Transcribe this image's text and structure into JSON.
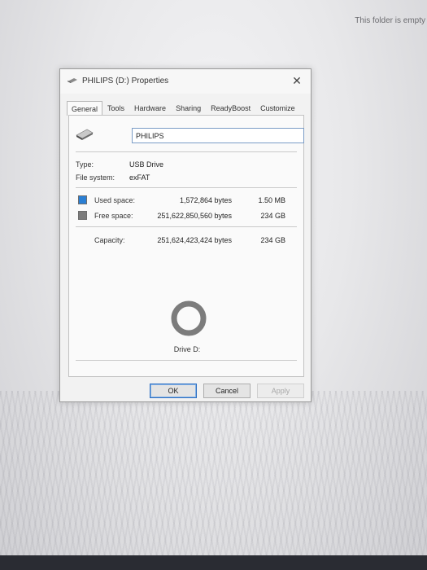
{
  "background": {
    "folder_status": "This folder is empty"
  },
  "dialog": {
    "title": "PHILIPS (D:) Properties",
    "close_glyph": "✕"
  },
  "tabs": [
    {
      "label": "General",
      "active": true
    },
    {
      "label": "Tools"
    },
    {
      "label": "Hardware"
    },
    {
      "label": "Sharing"
    },
    {
      "label": "ReadyBoost"
    },
    {
      "label": "Customize"
    }
  ],
  "general": {
    "volume_label": "PHILIPS",
    "type_label": "Type:",
    "type_value": "USB Drive",
    "fs_label": "File system:",
    "fs_value": "exFAT",
    "used": {
      "label": "Used space:",
      "bytes": "1,572,864 bytes",
      "size": "1.50 MB",
      "color": "#2a7fd4"
    },
    "free": {
      "label": "Free space:",
      "bytes": "251,622,850,560 bytes",
      "size": "234 GB",
      "color": "#7c7c7c"
    },
    "capacity": {
      "label": "Capacity:",
      "bytes": "251,624,423,424 bytes",
      "size": "234 GB"
    },
    "drive_label": "Drive D:"
  },
  "chart_data": {
    "type": "pie",
    "categories": [
      "Used space",
      "Free space"
    ],
    "values": [
      1572864,
      251622850560
    ],
    "colors": [
      "#2a7fd4",
      "#7c7c7c"
    ]
  },
  "buttons": {
    "ok": "OK",
    "cancel": "Cancel",
    "apply": "Apply"
  },
  "icons": {
    "title": "drive-icon",
    "drive": "usb-drive-icon",
    "close": "close-icon"
  }
}
